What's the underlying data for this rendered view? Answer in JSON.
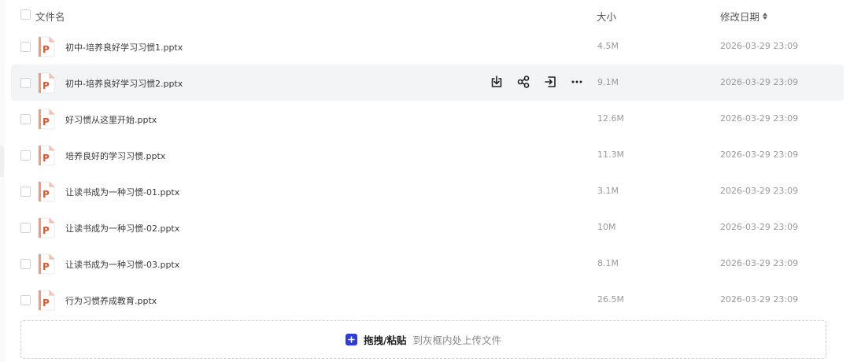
{
  "header": {
    "name_label": "文件名",
    "size_label": "大小",
    "date_label": "修改日期"
  },
  "rows": [
    {
      "name": "初中-培养良好学习习惯1.pptx",
      "size": "4.5M",
      "date": "2026-03-29 23:09"
    },
    {
      "name": "初中-培养良好学习习惯2.pptx",
      "size": "9.1M",
      "date": "2026-03-29 23:09"
    },
    {
      "name": "好习惯从这里开始.pptx",
      "size": "12.6M",
      "date": "2026-03-29 23:09"
    },
    {
      "name": "培养良好的学习习惯.pptx",
      "size": "11.3M",
      "date": "2026-03-29 23:09"
    },
    {
      "name": "让读书成为一种习惯-01.pptx",
      "size": "3.1M",
      "date": "2026-03-29 23:09"
    },
    {
      "name": "让读书成为一种习惯-02.pptx",
      "size": "10M",
      "date": "2026-03-29 23:09"
    },
    {
      "name": "让读书成为一种习惯-03.pptx",
      "size": "8.1M",
      "date": "2026-03-29 23:09"
    },
    {
      "name": "行为习惯养成教育.pptx",
      "size": "26.5M",
      "date": "2026-03-29 23:09"
    }
  ],
  "hovered_row_actions": [
    "download-icon",
    "share-icon",
    "move-icon",
    "more-icon"
  ],
  "file_icon": {
    "type": "ppt-file-icon",
    "letter": "P",
    "color": "#e2572b"
  },
  "upload": {
    "strong": "拖拽/粘贴",
    "hint": "到灰框内处上传文件",
    "accent": "#2f3bdb"
  }
}
